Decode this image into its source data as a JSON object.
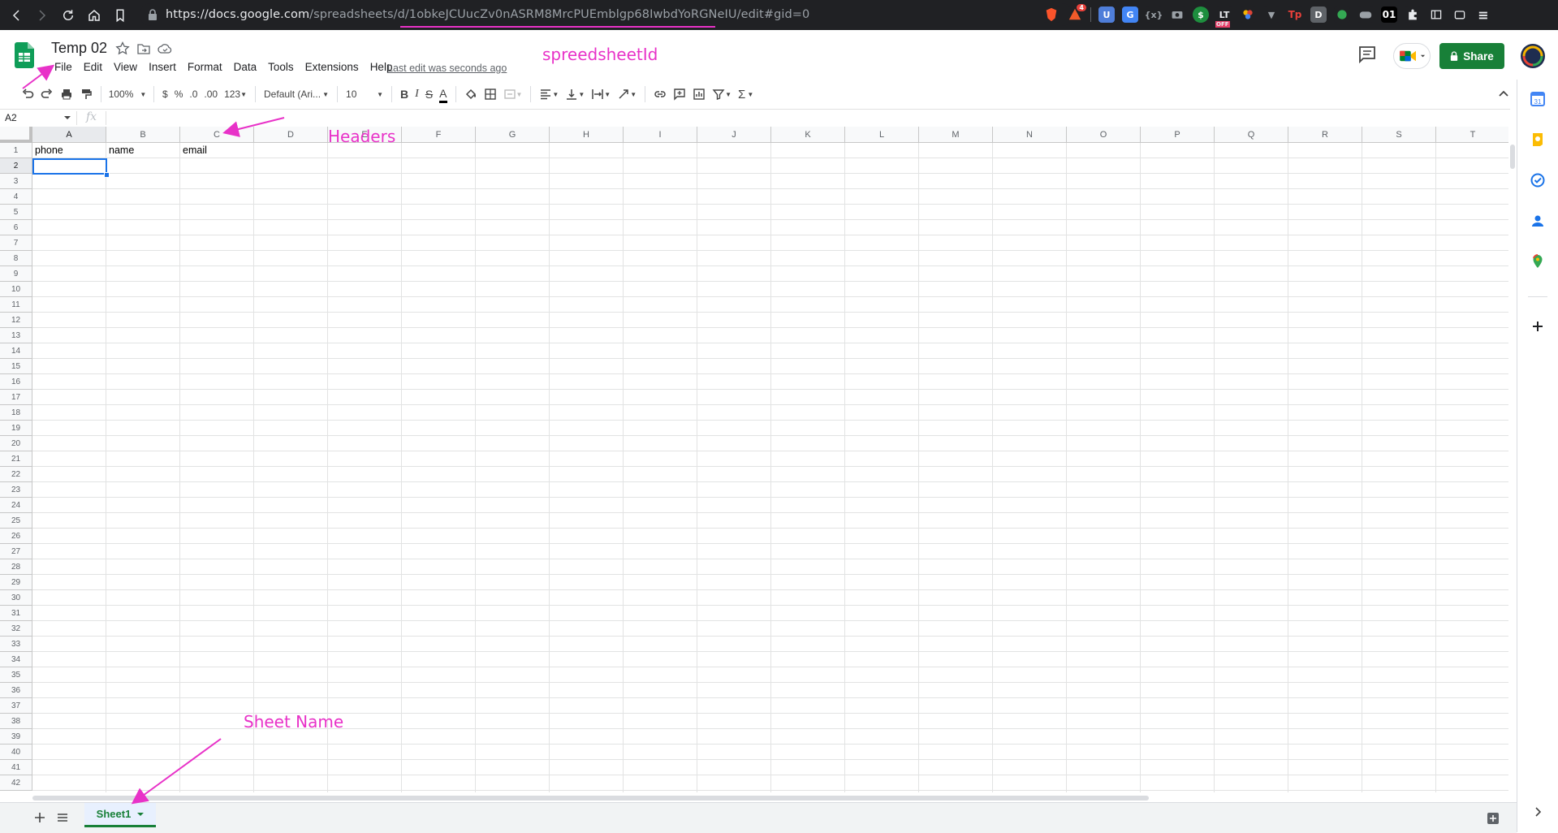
{
  "browser": {
    "url_prefix": "https://docs.google.com",
    "url_path": "/spreadsheets/d/",
    "url_id": "1obkeJCUucZv0nASRM8MrcPUEmblgp68IwbdYoRGNeIU",
    "url_suffix": "/edit#gid=0",
    "badge_count": "4",
    "ext_labels": {
      "off": "OFF",
      "tp": "Tp",
      "d": "D",
      "zero_one": "01"
    }
  },
  "header": {
    "title": "Temp 02",
    "last_edit": "Last edit was seconds ago",
    "share_label": "Share"
  },
  "menu": [
    "File",
    "Edit",
    "View",
    "Insert",
    "Format",
    "Data",
    "Tools",
    "Extensions",
    "Help"
  ],
  "toolbar": {
    "zoom": "100%",
    "currency": "$",
    "percent": "%",
    "decrease_decimal": ".0",
    "increase_decimal": ".00",
    "more_formats": "123",
    "font": "Default (Ari...",
    "font_size": "10",
    "bold": "B",
    "italic": "I",
    "strike": "S",
    "text_color": "A",
    "sum": "Σ"
  },
  "formula_bar": {
    "name_box": "A2",
    "fx": "fx",
    "value": ""
  },
  "grid": {
    "columns": [
      "A",
      "B",
      "C",
      "D",
      "E",
      "F",
      "G",
      "H",
      "I",
      "J",
      "K",
      "L",
      "M",
      "N",
      "O",
      "P",
      "Q",
      "R",
      "S",
      "T"
    ],
    "row_count": 42,
    "selected_cell": "A2",
    "cells": [
      {
        "ref": "A1",
        "value": "phone"
      },
      {
        "ref": "B1",
        "value": "name"
      },
      {
        "ref": "C1",
        "value": "email"
      }
    ]
  },
  "sheets": [
    {
      "name": "Sheet1",
      "active": true
    }
  ],
  "annotations": {
    "spreadsheet_id": "spreedsheetId",
    "headers": "Headers",
    "sheet_name": "Sheet Name"
  },
  "colors": {
    "accent_green": "#188038",
    "selection_blue": "#1a73e8",
    "annotation_magenta": "#e832c8"
  }
}
